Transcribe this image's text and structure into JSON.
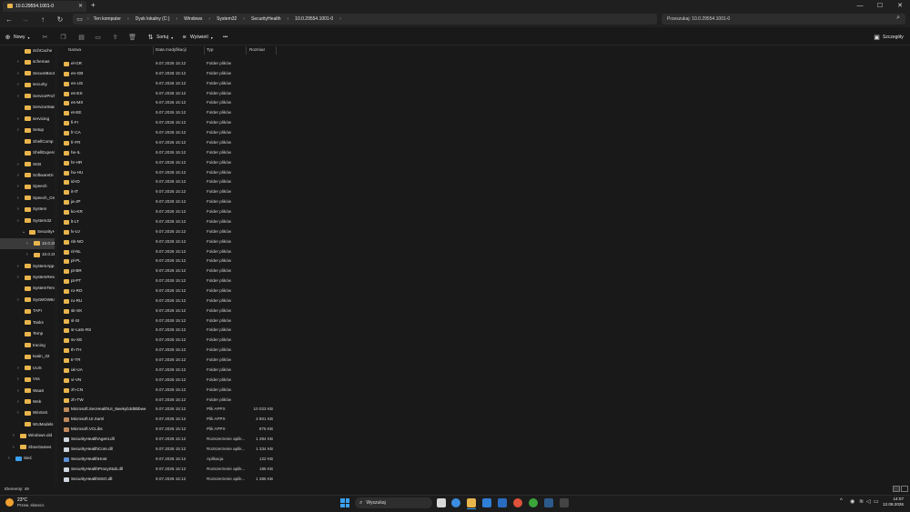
{
  "window": {
    "tab_title": "10.0.29554.1001-0",
    "new_tab": "+",
    "controls": {
      "minimize": "—",
      "maximize": "☐",
      "close": "✕"
    }
  },
  "address": {
    "breadcrumbs": [
      "Ten komputer",
      "Dysk lokalny (C:)",
      "Windows",
      "System32",
      "SecurityHealth",
      "10.0.29554.1001-0"
    ],
    "search_placeholder": "Przeszukaj: 10.0.29554.1001-0"
  },
  "toolbar": {
    "new_label": "Nowy",
    "sort_label": "Sortuj",
    "view_label": "Wyświetl",
    "more_label": "•••",
    "details_label": "Szczegóły"
  },
  "columns": {
    "name": "Nazwa",
    "date": "Data modyfikacji",
    "type": "Typ",
    "size": "Rozmiar"
  },
  "sidebar": {
    "items": [
      {
        "label": "SchCache",
        "indent": 1,
        "expand": false
      },
      {
        "label": "schemas",
        "indent": 1,
        "expand": true
      },
      {
        "label": "SecureBoot",
        "indent": 1,
        "expand": true
      },
      {
        "label": "security",
        "indent": 1,
        "expand": true
      },
      {
        "label": "ServiceProf",
        "indent": 1,
        "expand": true
      },
      {
        "label": "ServiceState",
        "indent": 1,
        "expand": false
      },
      {
        "label": "servicing",
        "indent": 1,
        "expand": true
      },
      {
        "label": "Setup",
        "indent": 1,
        "expand": true
      },
      {
        "label": "ShellComp",
        "indent": 1,
        "expand": false
      },
      {
        "label": "ShellExpere",
        "indent": 1,
        "expand": false
      },
      {
        "label": "SKB",
        "indent": 1,
        "expand": true
      },
      {
        "label": "SoftwareDi",
        "indent": 1,
        "expand": true
      },
      {
        "label": "Speech",
        "indent": 1,
        "expand": true
      },
      {
        "label": "Speech_On",
        "indent": 1,
        "expand": true
      },
      {
        "label": "System",
        "indent": 1,
        "expand": true
      },
      {
        "label": "System32",
        "indent": 1,
        "expand": true
      },
      {
        "label": "SecurityH",
        "indent": 2,
        "expand": true,
        "open": true
      },
      {
        "label": "10.0.295",
        "indent": 3,
        "expand": true,
        "selected": true
      },
      {
        "label": "10.0.296",
        "indent": 3,
        "expand": true
      },
      {
        "label": "SystemApp",
        "indent": 1,
        "expand": true
      },
      {
        "label": "SystemReso",
        "indent": 1,
        "expand": true
      },
      {
        "label": "SystemTem",
        "indent": 1,
        "expand": false
      },
      {
        "label": "SysWOW64",
        "indent": 1,
        "expand": true
      },
      {
        "label": "TAPI",
        "indent": 1,
        "expand": false
      },
      {
        "label": "Tasks",
        "indent": 1,
        "expand": false
      },
      {
        "label": "Temp",
        "indent": 1,
        "expand": false
      },
      {
        "label": "tracing",
        "indent": 1,
        "expand": false
      },
      {
        "label": "twain_32",
        "indent": 1,
        "expand": false
      },
      {
        "label": "UUS",
        "indent": 1,
        "expand": true
      },
      {
        "label": "Vss",
        "indent": 1,
        "expand": true
      },
      {
        "label": "WaaS",
        "indent": 1,
        "expand": true
      },
      {
        "label": "Web",
        "indent": 1,
        "expand": true
      },
      {
        "label": "WinSxS",
        "indent": 1,
        "expand": true
      },
      {
        "label": "WUModels",
        "indent": 1,
        "expand": false
      },
      {
        "label": "Windows.old",
        "indent": 0,
        "expand": true
      },
      {
        "label": "XboxGames",
        "indent": 0,
        "expand": true
      },
      {
        "label": "Sieć",
        "indent": -1,
        "expand": true,
        "network": true
      }
    ]
  },
  "files": [
    {
      "name": "el-GR",
      "date": "9.07.2026 15:12",
      "type": "Folder plików",
      "size": "",
      "kind": "folder"
    },
    {
      "name": "en-GB",
      "date": "9.07.2026 15:12",
      "type": "Folder plików",
      "size": "",
      "kind": "folder"
    },
    {
      "name": "en-US",
      "date": "9.07.2026 15:12",
      "type": "Folder plików",
      "size": "",
      "kind": "folder"
    },
    {
      "name": "es-ES",
      "date": "9.07.2026 15:12",
      "type": "Folder plików",
      "size": "",
      "kind": "folder"
    },
    {
      "name": "es-MX",
      "date": "9.07.2026 15:12",
      "type": "Folder plików",
      "size": "",
      "kind": "folder"
    },
    {
      "name": "et-EE",
      "date": "9.07.2026 15:12",
      "type": "Folder plików",
      "size": "",
      "kind": "folder"
    },
    {
      "name": "fi-FI",
      "date": "9.07.2026 15:12",
      "type": "Folder plików",
      "size": "",
      "kind": "folder"
    },
    {
      "name": "fr-CA",
      "date": "9.07.2026 15:12",
      "type": "Folder plików",
      "size": "",
      "kind": "folder"
    },
    {
      "name": "fr-FR",
      "date": "9.07.2026 15:12",
      "type": "Folder plików",
      "size": "",
      "kind": "folder"
    },
    {
      "name": "he-IL",
      "date": "9.07.2026 15:12",
      "type": "Folder plików",
      "size": "",
      "kind": "folder"
    },
    {
      "name": "hr-HR",
      "date": "9.07.2026 15:12",
      "type": "Folder plików",
      "size": "",
      "kind": "folder"
    },
    {
      "name": "hu-HU",
      "date": "9.07.2026 15:12",
      "type": "Folder plików",
      "size": "",
      "kind": "folder"
    },
    {
      "name": "id-ID",
      "date": "9.07.2026 15:12",
      "type": "Folder plików",
      "size": "",
      "kind": "folder"
    },
    {
      "name": "it-IT",
      "date": "9.07.2026 15:12",
      "type": "Folder plików",
      "size": "",
      "kind": "folder"
    },
    {
      "name": "ja-JP",
      "date": "9.07.2026 15:12",
      "type": "Folder plików",
      "size": "",
      "kind": "folder"
    },
    {
      "name": "ko-KR",
      "date": "9.07.2026 15:12",
      "type": "Folder plików",
      "size": "",
      "kind": "folder"
    },
    {
      "name": "lt-LT",
      "date": "9.07.2026 15:12",
      "type": "Folder plików",
      "size": "",
      "kind": "folder"
    },
    {
      "name": "lv-LV",
      "date": "9.07.2026 15:12",
      "type": "Folder plików",
      "size": "",
      "kind": "folder"
    },
    {
      "name": "nb-NO",
      "date": "9.07.2026 15:12",
      "type": "Folder plików",
      "size": "",
      "kind": "folder"
    },
    {
      "name": "nl-NL",
      "date": "9.07.2026 15:12",
      "type": "Folder plików",
      "size": "",
      "kind": "folder"
    },
    {
      "name": "pl-PL",
      "date": "9.07.2026 15:12",
      "type": "Folder plików",
      "size": "",
      "kind": "folder"
    },
    {
      "name": "pt-BR",
      "date": "9.07.2026 15:12",
      "type": "Folder plików",
      "size": "",
      "kind": "folder"
    },
    {
      "name": "pt-PT",
      "date": "9.07.2026 15:12",
      "type": "Folder plików",
      "size": "",
      "kind": "folder"
    },
    {
      "name": "ro-RO",
      "date": "9.07.2026 15:12",
      "type": "Folder plików",
      "size": "",
      "kind": "folder"
    },
    {
      "name": "ru-RU",
      "date": "9.07.2026 15:12",
      "type": "Folder plików",
      "size": "",
      "kind": "folder"
    },
    {
      "name": "sk-SK",
      "date": "9.07.2026 15:12",
      "type": "Folder plików",
      "size": "",
      "kind": "folder"
    },
    {
      "name": "sl-SI",
      "date": "9.07.2026 15:12",
      "type": "Folder plików",
      "size": "",
      "kind": "folder"
    },
    {
      "name": "sr-Latn-RS",
      "date": "9.07.2026 15:12",
      "type": "Folder plików",
      "size": "",
      "kind": "folder"
    },
    {
      "name": "sv-SE",
      "date": "9.07.2026 15:12",
      "type": "Folder plików",
      "size": "",
      "kind": "folder"
    },
    {
      "name": "th-TH",
      "date": "9.07.2026 15:12",
      "type": "Folder plików",
      "size": "",
      "kind": "folder"
    },
    {
      "name": "tr-TR",
      "date": "9.07.2026 15:12",
      "type": "Folder plików",
      "size": "",
      "kind": "folder"
    },
    {
      "name": "uk-UA",
      "date": "9.07.2026 15:12",
      "type": "Folder plików",
      "size": "",
      "kind": "folder"
    },
    {
      "name": "vi-VN",
      "date": "9.07.2026 15:12",
      "type": "Folder plików",
      "size": "",
      "kind": "folder"
    },
    {
      "name": "zh-CN",
      "date": "9.07.2026 15:12",
      "type": "Folder plików",
      "size": "",
      "kind": "folder"
    },
    {
      "name": "zh-TW",
      "date": "9.07.2026 15:12",
      "type": "Folder plików",
      "size": "",
      "kind": "folder"
    },
    {
      "name": "Microsoft.SecHealthUI_8wekyb3d8bbwe",
      "date": "9.07.2026 15:12",
      "type": "Plik APPX",
      "size": "10 023 KB",
      "kind": "appx"
    },
    {
      "name": "Microsoft.UI.Xaml",
      "date": "9.07.2026 15:12",
      "type": "Plik APPX",
      "size": "4 801 KB",
      "kind": "appx"
    },
    {
      "name": "Microsoft.VCLibs",
      "date": "9.07.2026 15:12",
      "type": "Plik APPX",
      "size": "876 KB",
      "kind": "appx"
    },
    {
      "name": "SecurityHealthAgent.dll",
      "date": "9.07.2026 15:12",
      "type": "Rozszerzenie aplik...",
      "size": "1 394 KB",
      "kind": "dll"
    },
    {
      "name": "SecurityHealthCore.dll",
      "date": "9.07.2026 15:12",
      "type": "Rozszerzenie aplik...",
      "size": "1 334 KB",
      "kind": "dll"
    },
    {
      "name": "SecurityHealthHost",
      "date": "9.07.2026 15:12",
      "type": "Aplikacja",
      "size": "122 KB",
      "kind": "exe"
    },
    {
      "name": "SecurityHealthProxyStub.dll",
      "date": "9.07.2026 15:12",
      "type": "Rozszerzenie aplik...",
      "size": "186 KB",
      "kind": "dll"
    },
    {
      "name": "SecurityHealthSSO.dll",
      "date": "9.07.2026 15:12",
      "type": "Rozszerzenie aplik...",
      "size": "1 386 KB",
      "kind": "dll"
    }
  ],
  "statusbar": {
    "count": "Elementy: 49"
  },
  "taskbar": {
    "weather_temp": "23°C",
    "weather_desc": "Przew. słonecz.",
    "search_label": "Wyszukaj",
    "time": "14:07",
    "date": "12.08.2026"
  },
  "colors": {
    "accent": "#3aa0f0",
    "folder": "#e8b44c",
    "background": "#191919"
  }
}
